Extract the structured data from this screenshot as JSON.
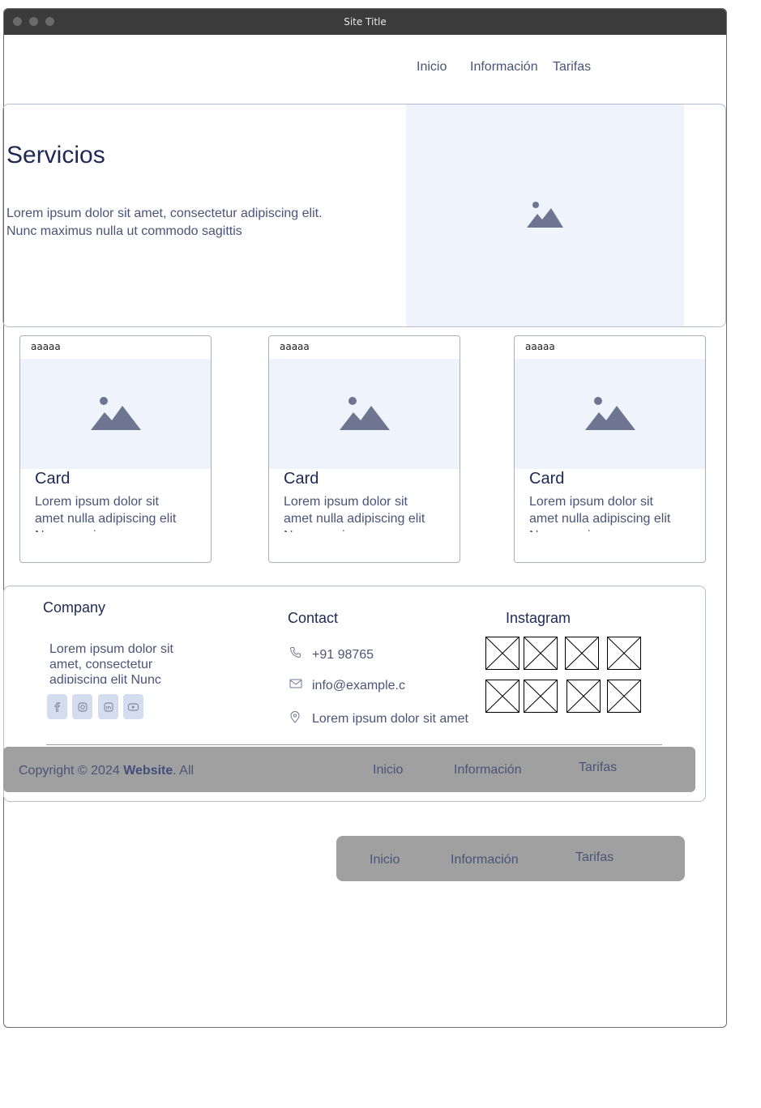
{
  "window": {
    "title": "Site Title"
  },
  "nav": {
    "items": [
      "Inicio",
      "Información",
      "Tarifas"
    ]
  },
  "hero": {
    "title": "Servicios",
    "text": "Lorem ipsum dolor sit amet, consectetur adipiscing elit. Nunc maximus nulla ut commodo sagittis"
  },
  "cards": [
    {
      "tag": "aaaaa",
      "title": "Card",
      "text": "Lorem ipsum dolor sit amet nulla adipiscing elit Nunc maximus"
    },
    {
      "tag": "aaaaa",
      "title": "Card",
      "text": "Lorem ipsum dolor sit amet nulla adipiscing elit Nunc maximus"
    },
    {
      "tag": "aaaaa",
      "title": "Card",
      "text": "Lorem ipsum dolor sit amet nulla adipiscing elit Nunc maximus"
    }
  ],
  "footer": {
    "company": {
      "heading": "Company",
      "text": "Lorem ipsum dolor sit amet, consectetur adipiscing elit Nunc maximus"
    },
    "social_icons": [
      "facebook-icon",
      "instagram-icon",
      "linkedin-icon",
      "youtube-icon"
    ],
    "contact": {
      "heading": "Contact",
      "phone": "+91 98765",
      "email": "info@example.c",
      "address": "Lorem ipsum dolor sit amet"
    },
    "instagram": {
      "heading": "Instagram",
      "image_count": 8
    },
    "copyright": {
      "prefix": "Copyright © 2024 ",
      "brand": "Website",
      "suffix": ". All"
    },
    "links": [
      "Inicio",
      "Información",
      "Tarifas"
    ]
  },
  "bottom_nav": {
    "items": [
      "Inicio",
      "Información",
      "Tarifas"
    ]
  },
  "colors": {
    "titlebar": "#3b3b3b",
    "placeholder_bg": "#eff4fc",
    "bar_bg": "#a0a0a0",
    "heading": "#1e2a55",
    "body_text": "#4a5478"
  }
}
